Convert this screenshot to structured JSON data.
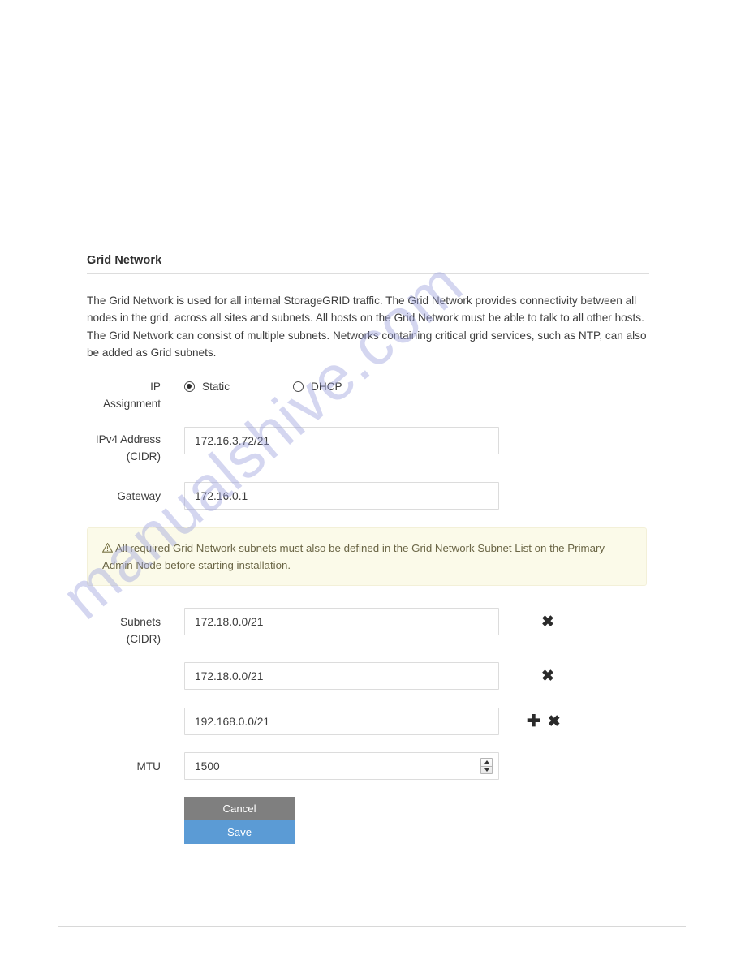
{
  "section": {
    "heading": "Grid Network",
    "description": "The Grid Network is used for all internal StorageGRID traffic. The Grid Network provides connectivity between all nodes in the grid, across all sites and subnets. All hosts on the Grid Network must be able to talk to all other hosts. The Grid Network can consist of multiple subnets. Networks containing critical grid services, such as NTP, can also be added as Grid subnets."
  },
  "form": {
    "ip_assignment": {
      "label_line1": "IP",
      "label_line2": "Assignment",
      "options": [
        {
          "label": "Static",
          "selected": true
        },
        {
          "label": "DHCP",
          "selected": false
        }
      ]
    },
    "ipv4_address": {
      "label_line1": "IPv4 Address",
      "label_line2": "(CIDR)",
      "value": "172.16.3.72/21"
    },
    "gateway": {
      "label": "Gateway",
      "value": "172.16.0.1"
    },
    "subnets": {
      "label_line1": "Subnets",
      "label_line2": "(CIDR)",
      "rows": [
        {
          "value": "172.18.0.0/21",
          "remove_icon": "✖",
          "add_icon": ""
        },
        {
          "value": "172.18.0.0/21",
          "remove_icon": "✖",
          "add_icon": ""
        },
        {
          "value": "192.168.0.0/21",
          "remove_icon": "✖",
          "add_icon": "✚"
        }
      ]
    },
    "mtu": {
      "label": "MTU",
      "value": "1500"
    }
  },
  "warning": {
    "icon": "warning-triangle-icon",
    "text": "All required Grid Network subnets must also be defined in the Grid Network Subnet List on the Primary Admin Node before starting installation."
  },
  "actions": {
    "cancel_label": "Cancel",
    "save_label": "Save"
  },
  "watermark": {
    "text": "manualshive.com"
  },
  "colors": {
    "save_button": "#5b9bd5",
    "cancel_button": "#7f7f7f",
    "warning_background": "#fbfae9",
    "warning_text": "#6b6646",
    "watermark": "#9aa0dd"
  }
}
